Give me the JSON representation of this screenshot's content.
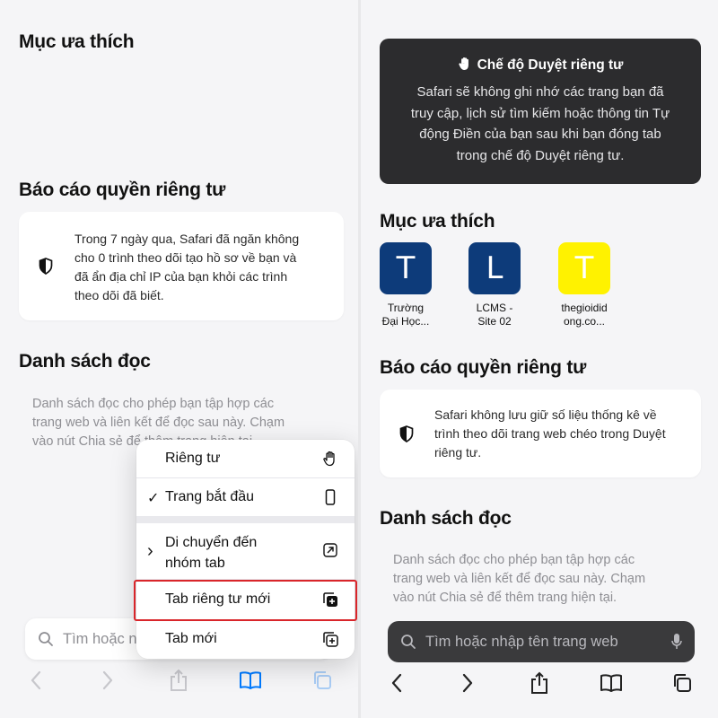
{
  "left": {
    "favorites_title": "Mục ưa thích",
    "privacy_title": "Báo cáo quyền riêng tư",
    "privacy_text_lines": [
      "Trong 7 ngày qua, Safari đã ngăn không",
      "cho 0 trình theo dõi tạo hồ sơ về bạn và",
      "đã ẩn địa chỉ IP của bạn khỏi các trình",
      "theo dõi đã biết."
    ],
    "reading_title": "Danh sách đọc",
    "reading_text_lines": [
      "Danh sách đọc cho phép bạn tập hợp các",
      "trang web và liên kết để đọc sau này. Chạm",
      "vào nút Chia sẻ để thêm trang hiện tại."
    ],
    "search_placeholder": "Tìm hoặc nhập tên trang web",
    "context_menu": {
      "private": "Riêng tư",
      "start_page_check": "✓",
      "start_page": "Trang bắt đầu",
      "move_chevron": "›",
      "move_line1": "Di chuyển đến",
      "move_line2": "nhóm tab",
      "new_private_tab": "Tab riêng tư mới",
      "new_tab": "Tab mới"
    }
  },
  "right": {
    "banner_title": "Chế độ Duyệt riêng tư",
    "banner_lines": [
      "Safari sẽ không ghi nhớ các trang bạn đã",
      "truy cập, lịch sử tìm kiếm hoặc thông tin Tự",
      "động Điền của bạn sau khi bạn đóng tab",
      "trong chế độ Duyệt riêng tư."
    ],
    "favorites_title": "Mục ưa thích",
    "favorites": [
      {
        "letter": "T",
        "line1": "Trường",
        "line2": "Đại Học...",
        "color": "#0d3b7a"
      },
      {
        "letter": "L",
        "line1": "LCMS -",
        "line2": "Site 02",
        "color": "#0d3b7a"
      },
      {
        "letter": "T",
        "line1": "thegioidid",
        "line2": "ong.co...",
        "color": "#fff200"
      }
    ],
    "privacy_title": "Báo cáo quyền riêng tư",
    "privacy_text_lines": [
      "Safari không lưu giữ số liệu thống kê về",
      "trình theo dõi trang web chéo trong Duyệt",
      "riêng tư."
    ],
    "reading_title": "Danh sách đọc",
    "reading_text_lines": [
      "Danh sách đọc cho phép bạn tập hợp các",
      "trang web và liên kết để đọc sau này. Chạm",
      "vào nút Chia sẻ để thêm trang hiện tại."
    ],
    "search_placeholder": "Tìm hoặc nhập tên trang web"
  },
  "colors": {
    "accent": "#007aff",
    "highlight": "#d9252a",
    "private_banner": "#2c2c2e"
  }
}
